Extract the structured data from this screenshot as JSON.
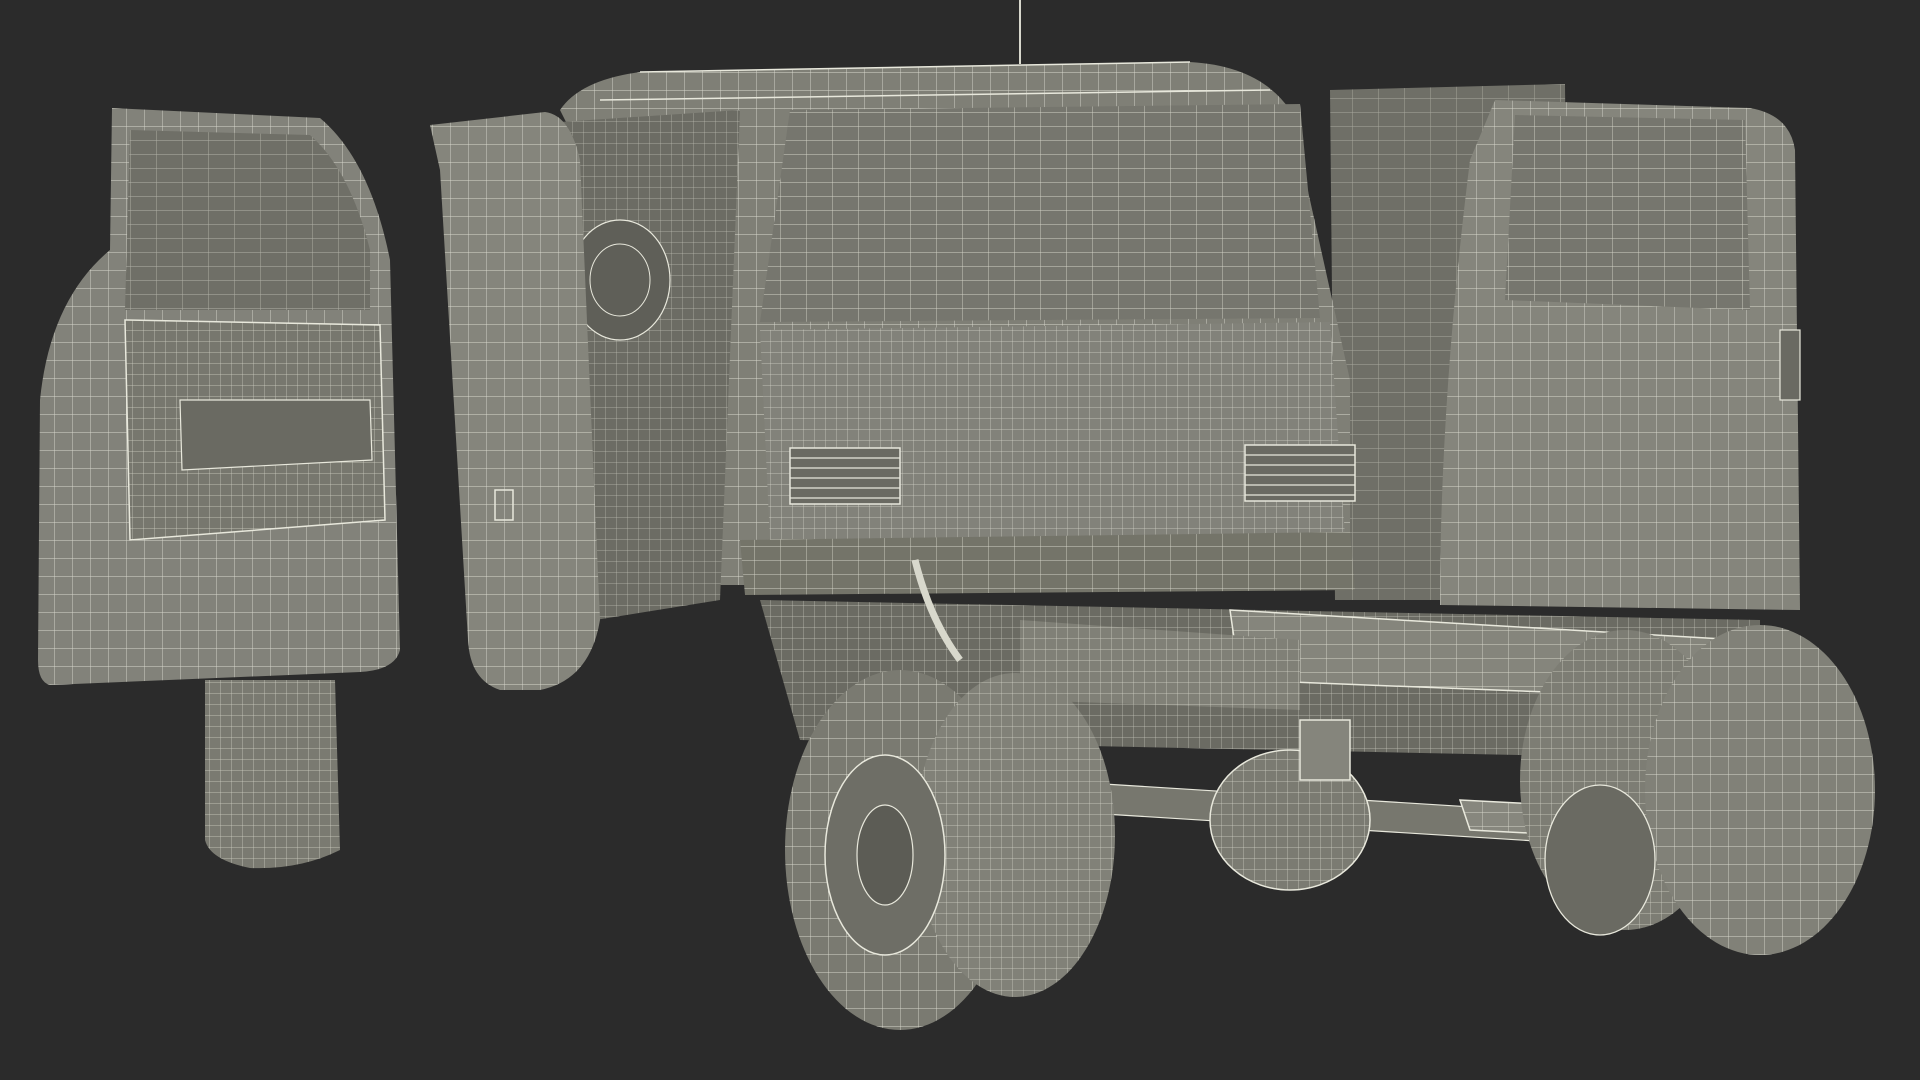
{
  "scene": {
    "background_color": "#2b2b2b",
    "model_fill": "#7d7d74",
    "model_fill_dark": "#6b6b63",
    "model_fill_light": "#8a8a80",
    "wire_color": "#e8e8dc",
    "subject": "wireframe-render-of-pickup-truck-cab-chassis-rear-view"
  }
}
